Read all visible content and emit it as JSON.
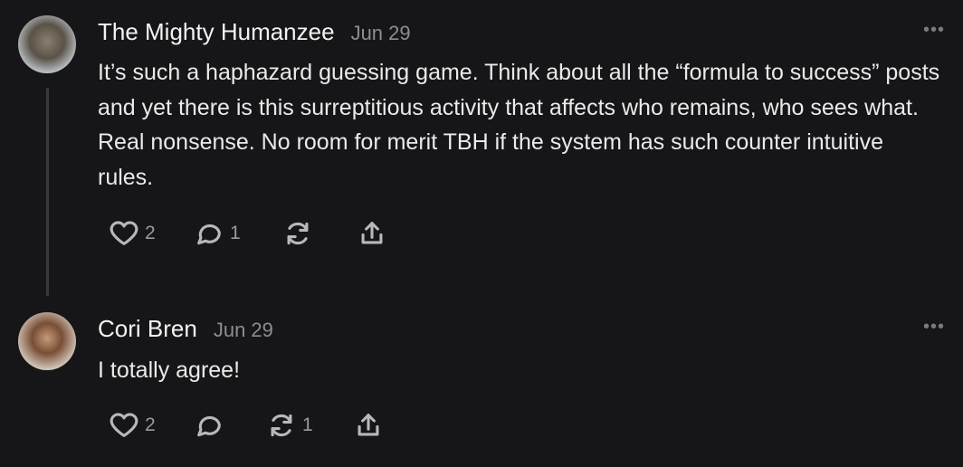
{
  "comments": [
    {
      "author": "The Mighty Humanzee",
      "date": "Jun 29",
      "more": "•••",
      "text": "It’s such a haphazard guessing game. Think about all the “formula to success” posts and yet there is this surreptitious activity that affects who remains, who sees what. Real nonsense. No room for merit TBH if the system has such counter intuitive rules.",
      "likes": "2",
      "replies": "1",
      "restacks": "",
      "icons": [
        "heart-icon",
        "comment-icon",
        "restack-icon",
        "share-icon"
      ]
    },
    {
      "author": "Cori Bren",
      "date": "Jun 29",
      "more": "•••",
      "text": "I totally agree!",
      "likes": "2",
      "replies": "",
      "restacks": "1",
      "icons": [
        "heart-icon",
        "comment-icon",
        "restack-icon",
        "share-icon"
      ]
    }
  ]
}
